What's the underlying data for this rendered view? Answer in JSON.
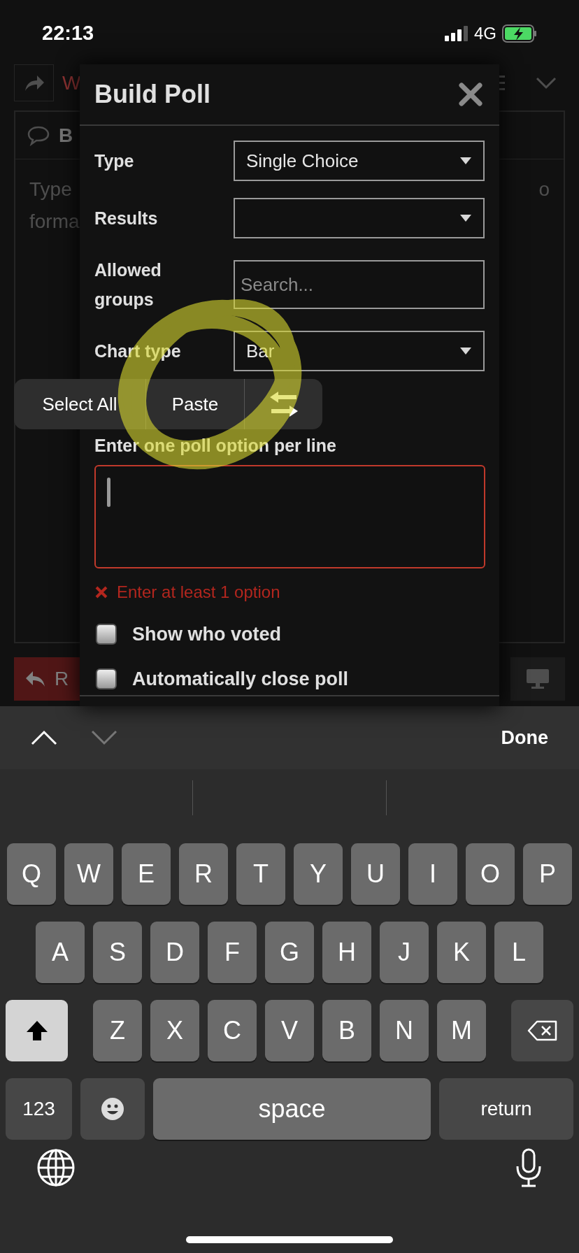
{
  "status_bar": {
    "time": "22:13",
    "network": "4G"
  },
  "background": {
    "toolbar_fragment": "W",
    "panel_fragment": "B",
    "text_left": [
      "Type",
      "forma"
    ],
    "text_right": "o",
    "button_fragment": "R"
  },
  "modal": {
    "title": "Build Poll",
    "fields": [
      {
        "kind": "select",
        "label": "Type",
        "value": "Single Choice"
      },
      {
        "kind": "select",
        "label": "Results"
      },
      {
        "kind": "search",
        "label": "Allowed groups",
        "placeholder": "Search..."
      },
      {
        "kind": "select",
        "label": "Chart type",
        "value": "Bar"
      }
    ],
    "options_label": "Enter one poll option per line",
    "options_invalid": true,
    "error": "Enter at least 1 option",
    "checkboxes": [
      {
        "label": "Show who voted",
        "checked": false
      },
      {
        "label": "Automatically close poll",
        "checked": false
      }
    ]
  },
  "context_menu": {
    "items": [
      "Select All",
      "Paste"
    ]
  },
  "keyboard": {
    "done": "Done",
    "rows": [
      [
        "Q",
        "W",
        "E",
        "R",
        "T",
        "Y",
        "U",
        "I",
        "O",
        "P"
      ],
      [
        "A",
        "S",
        "D",
        "F",
        "G",
        "H",
        "J",
        "K",
        "L"
      ],
      [
        "Z",
        "X",
        "C",
        "V",
        "B",
        "N",
        "M"
      ]
    ],
    "numbers_key": "123",
    "space": "space",
    "return": "return"
  }
}
